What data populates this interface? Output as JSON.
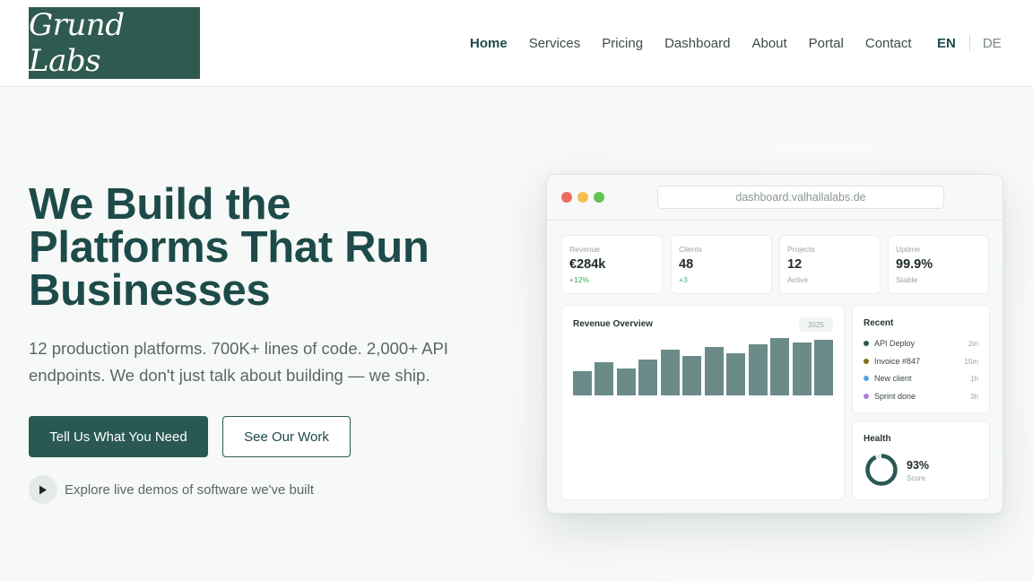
{
  "header": {
    "logo_text": "Grund Labs",
    "nav": [
      {
        "label": "Home",
        "active": true
      },
      {
        "label": "Services",
        "active": false
      },
      {
        "label": "Pricing",
        "active": false
      },
      {
        "label": "Dashboard",
        "active": false
      },
      {
        "label": "About",
        "active": false
      },
      {
        "label": "Portal",
        "active": false
      },
      {
        "label": "Contact",
        "active": false
      }
    ],
    "lang_active": "EN",
    "lang_other": "DE"
  },
  "hero": {
    "headline": [
      "We Build the",
      "Platforms That Run",
      "Businesses"
    ],
    "subtext_line1": "12 production platforms. 700K+ lines of code. 2,000+ API",
    "subtext_line2": "endpoints. We don't just talk about building — we ship.",
    "primary_cta": "Tell Us What You Need",
    "secondary_cta": "See Our Work",
    "demo_link": "Explore live demos of software we've built"
  },
  "mockup": {
    "url": "dashboard.valhallalabs.de",
    "stats": [
      {
        "label": "Revenue",
        "value": "€284k",
        "note": "+12%",
        "positive": true
      },
      {
        "label": "Clients",
        "value": "48",
        "note": "+3",
        "positive": true
      },
      {
        "label": "Projects",
        "value": "12",
        "note": "Active",
        "positive": false
      },
      {
        "label": "Uptime",
        "value": "99.9%",
        "note": "Stable",
        "positive": false
      }
    ],
    "revenue_overview": {
      "title": "Revenue Overview",
      "year": "2025",
      "bars": [
        27,
        37,
        30,
        40,
        51,
        44,
        54,
        47,
        57,
        64,
        59,
        62
      ],
      "bar_max": 64
    },
    "recent": {
      "title": "Recent",
      "items": [
        {
          "label": "API Deploy",
          "time": "2m",
          "color": "#2f5a4f"
        },
        {
          "label": "Invoice #847",
          "time": "15m",
          "color": "#8a6d1a"
        },
        {
          "label": "New client",
          "time": "1h",
          "color": "#5aa5e0"
        },
        {
          "label": "Sprint done",
          "time": "3h",
          "color": "#b07fd6"
        }
      ]
    },
    "health": {
      "title": "Health",
      "value": "93%",
      "percent": 93,
      "sub": "Score"
    }
  },
  "colors": {
    "brand": "#2f5a4f",
    "accent": "#1d4b49",
    "bar": "#6b8b88",
    "positive": "#3fae6b",
    "dot_red": "#ed6a5e",
    "dot_yellow": "#f5bf4f",
    "dot_green": "#61c554"
  }
}
